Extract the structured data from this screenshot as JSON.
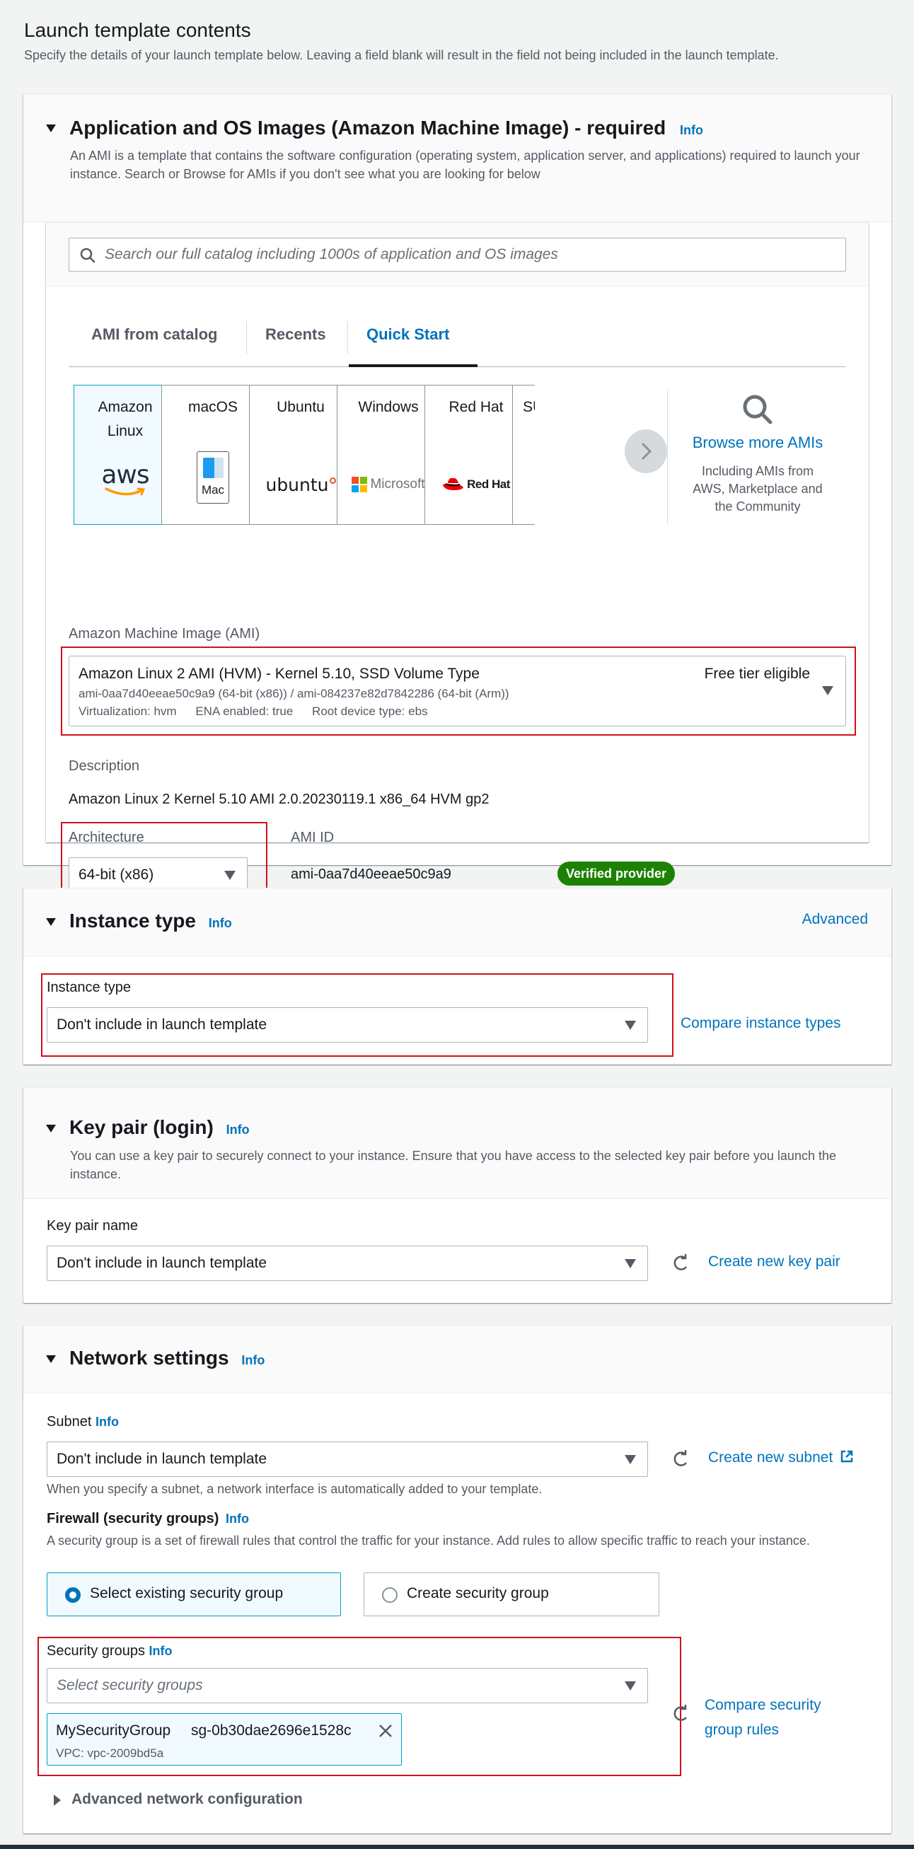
{
  "page": {
    "title": "Launch template contents",
    "subtitle": "Specify the details of your launch template below. Leaving a field blank will result in the field not being included in the launch template."
  },
  "ami_section": {
    "title": "Application and OS Images (Amazon Machine Image) - required",
    "info": "Info",
    "description": "An AMI is a template that contains the software configuration (operating system, application server, and applications) required to launch your instance. Search or Browse for AMIs if you don't see what you are looking for below",
    "search_placeholder": "Search our full catalog including 1000s of application and OS images",
    "tabs": [
      {
        "label": "AMI from catalog",
        "active": false
      },
      {
        "label": "Recents",
        "active": false
      },
      {
        "label": "Quick Start",
        "active": true
      }
    ],
    "os_tiles": [
      {
        "name": "Amazon Linux",
        "logo": "aws-logo",
        "selected": true
      },
      {
        "name": "macOS",
        "logo": "mac-logo",
        "logo_text": "Mac",
        "selected": false
      },
      {
        "name": "Ubuntu",
        "logo": "ubuntu-logo",
        "logo_text": "ubuntu",
        "selected": false
      },
      {
        "name": "Windows",
        "logo": "microsoft-logo",
        "logo_text": "Microsoft",
        "selected": false
      },
      {
        "name": "Red Hat",
        "logo": "redhat-logo",
        "logo_text": "Red Hat",
        "selected": false
      },
      {
        "name": "SUSE",
        "visible_text": "SU",
        "selected": false
      }
    ],
    "aws_logo_text": "aws",
    "browse_more": {
      "title": "Browse more AMIs",
      "description": "Including AMIs from AWS, Marketplace and the Community"
    },
    "ami_label": "Amazon Machine Image (AMI)",
    "ami_selected": {
      "name": "Amazon Linux 2 AMI (HVM) - Kernel 5.10, SSD Volume Type",
      "ids": "ami-0aa7d40eeae50c9a9 (64-bit (x86)) / ami-084237e82d7842286 (64-bit (Arm))",
      "virtualization": "Virtualization: hvm",
      "ena": "ENA enabled: true",
      "root_device": "Root device type: ebs",
      "tier": "Free tier eligible"
    },
    "description_label": "Description",
    "description_value": "Amazon Linux 2 Kernel 5.10 AMI 2.0.20230119.1 x86_64 HVM gp2",
    "architecture_label": "Architecture",
    "architecture_value": "64-bit (x86)",
    "ami_id_label": "AMI ID",
    "ami_id_value": "ami-0aa7d40eeae50c9a9",
    "verified_badge": "Verified provider"
  },
  "instance_type_section": {
    "title": "Instance type",
    "info": "Info",
    "advanced_link": "Advanced",
    "field_label": "Instance type",
    "field_value": "Don't include in launch template",
    "compare_link": "Compare instance types"
  },
  "key_pair_section": {
    "title": "Key pair (login)",
    "info": "Info",
    "description": "You can use a key pair to securely connect to your instance. Ensure that you have access to the selected key pair before you launch the instance.",
    "field_label": "Key pair name",
    "field_value": "Don't include in launch template",
    "create_link": "Create new key pair"
  },
  "network_section": {
    "title": "Network settings",
    "info": "Info",
    "subnet_label": "Subnet",
    "subnet_info": "Info",
    "subnet_value": "Don't include in launch template",
    "create_subnet_link": "Create new subnet",
    "subnet_help": "When you specify a subnet, a network interface is automatically added to your template.",
    "firewall_label": "Firewall (security groups)",
    "firewall_info": "Info",
    "firewall_description": "A security group is a set of firewall rules that control the traffic for your instance. Add rules to allow specific traffic to reach your instance.",
    "firewall_options": [
      {
        "label": "Select existing security group",
        "selected": true
      },
      {
        "label": "Create security group",
        "selected": false
      }
    ],
    "security_groups_label": "Security groups",
    "security_groups_info": "Info",
    "security_groups_placeholder": "Select security groups",
    "selected_group": {
      "name": "MySecurityGroup",
      "id": "sg-0b30dae2696e1528c",
      "vpc": "VPC: vpc-2009bd5a"
    },
    "compare_link": "Compare security group rules",
    "advanced_toggle": "Advanced network configuration"
  },
  "colors": {
    "link": "#0073bb",
    "highlight_outline": "#d0101a",
    "verified_badge": "#1d8102",
    "selected_tile_bg": "#f1faff",
    "selected_tile_border": "#00a1c9"
  }
}
